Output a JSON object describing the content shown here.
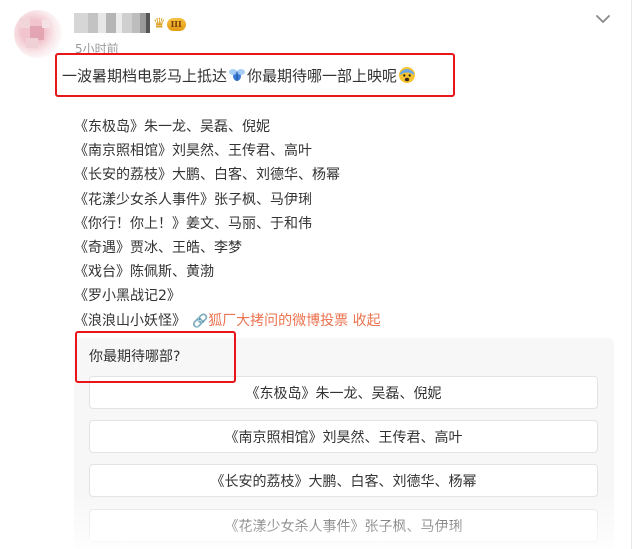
{
  "post": {
    "time": "5小时前",
    "badge_level": "III",
    "headline_part1": "一波暑期档电影马上抵达",
    "headline_part2": "你最期待哪一部上映呢",
    "movies": [
      "《东极岛》朱一龙、吴磊、倪妮",
      "《南京照相馆》刘昊然、王传君、高叶",
      "《长安的荔枝》大鹏、白客、刘德华、杨幂",
      "《花漾少女杀人事件》张子枫、马伊琍",
      "《你行！你上！》姜文、马丽、于和伟",
      "《奇遇》贾冰、王皓、李梦",
      "《戏台》陈佩斯、黄渤",
      "《罗小黑战记2》",
      "《浪浪山小妖怪》"
    ],
    "link_text": "狐厂大拷问的微博投票",
    "collapse_text": "收起"
  },
  "poll": {
    "question": "你最期待哪部?",
    "options": [
      "《东极岛》朱一龙、吴磊、倪妮",
      "《南京照相馆》刘昊然、王传君、高叶",
      "《长安的荔枝》大鹏、白客、刘德华、杨幂",
      "《花漾少女杀人事件》张子枫、马伊琍"
    ]
  },
  "colors": {
    "link": "#eb7350",
    "highlight_box": "#e8161b"
  },
  "icons": [
    "chevron-down-icon",
    "crown-icon",
    "bug-emoji-icon",
    "fearful-face-emoji-icon",
    "link-icon"
  ]
}
